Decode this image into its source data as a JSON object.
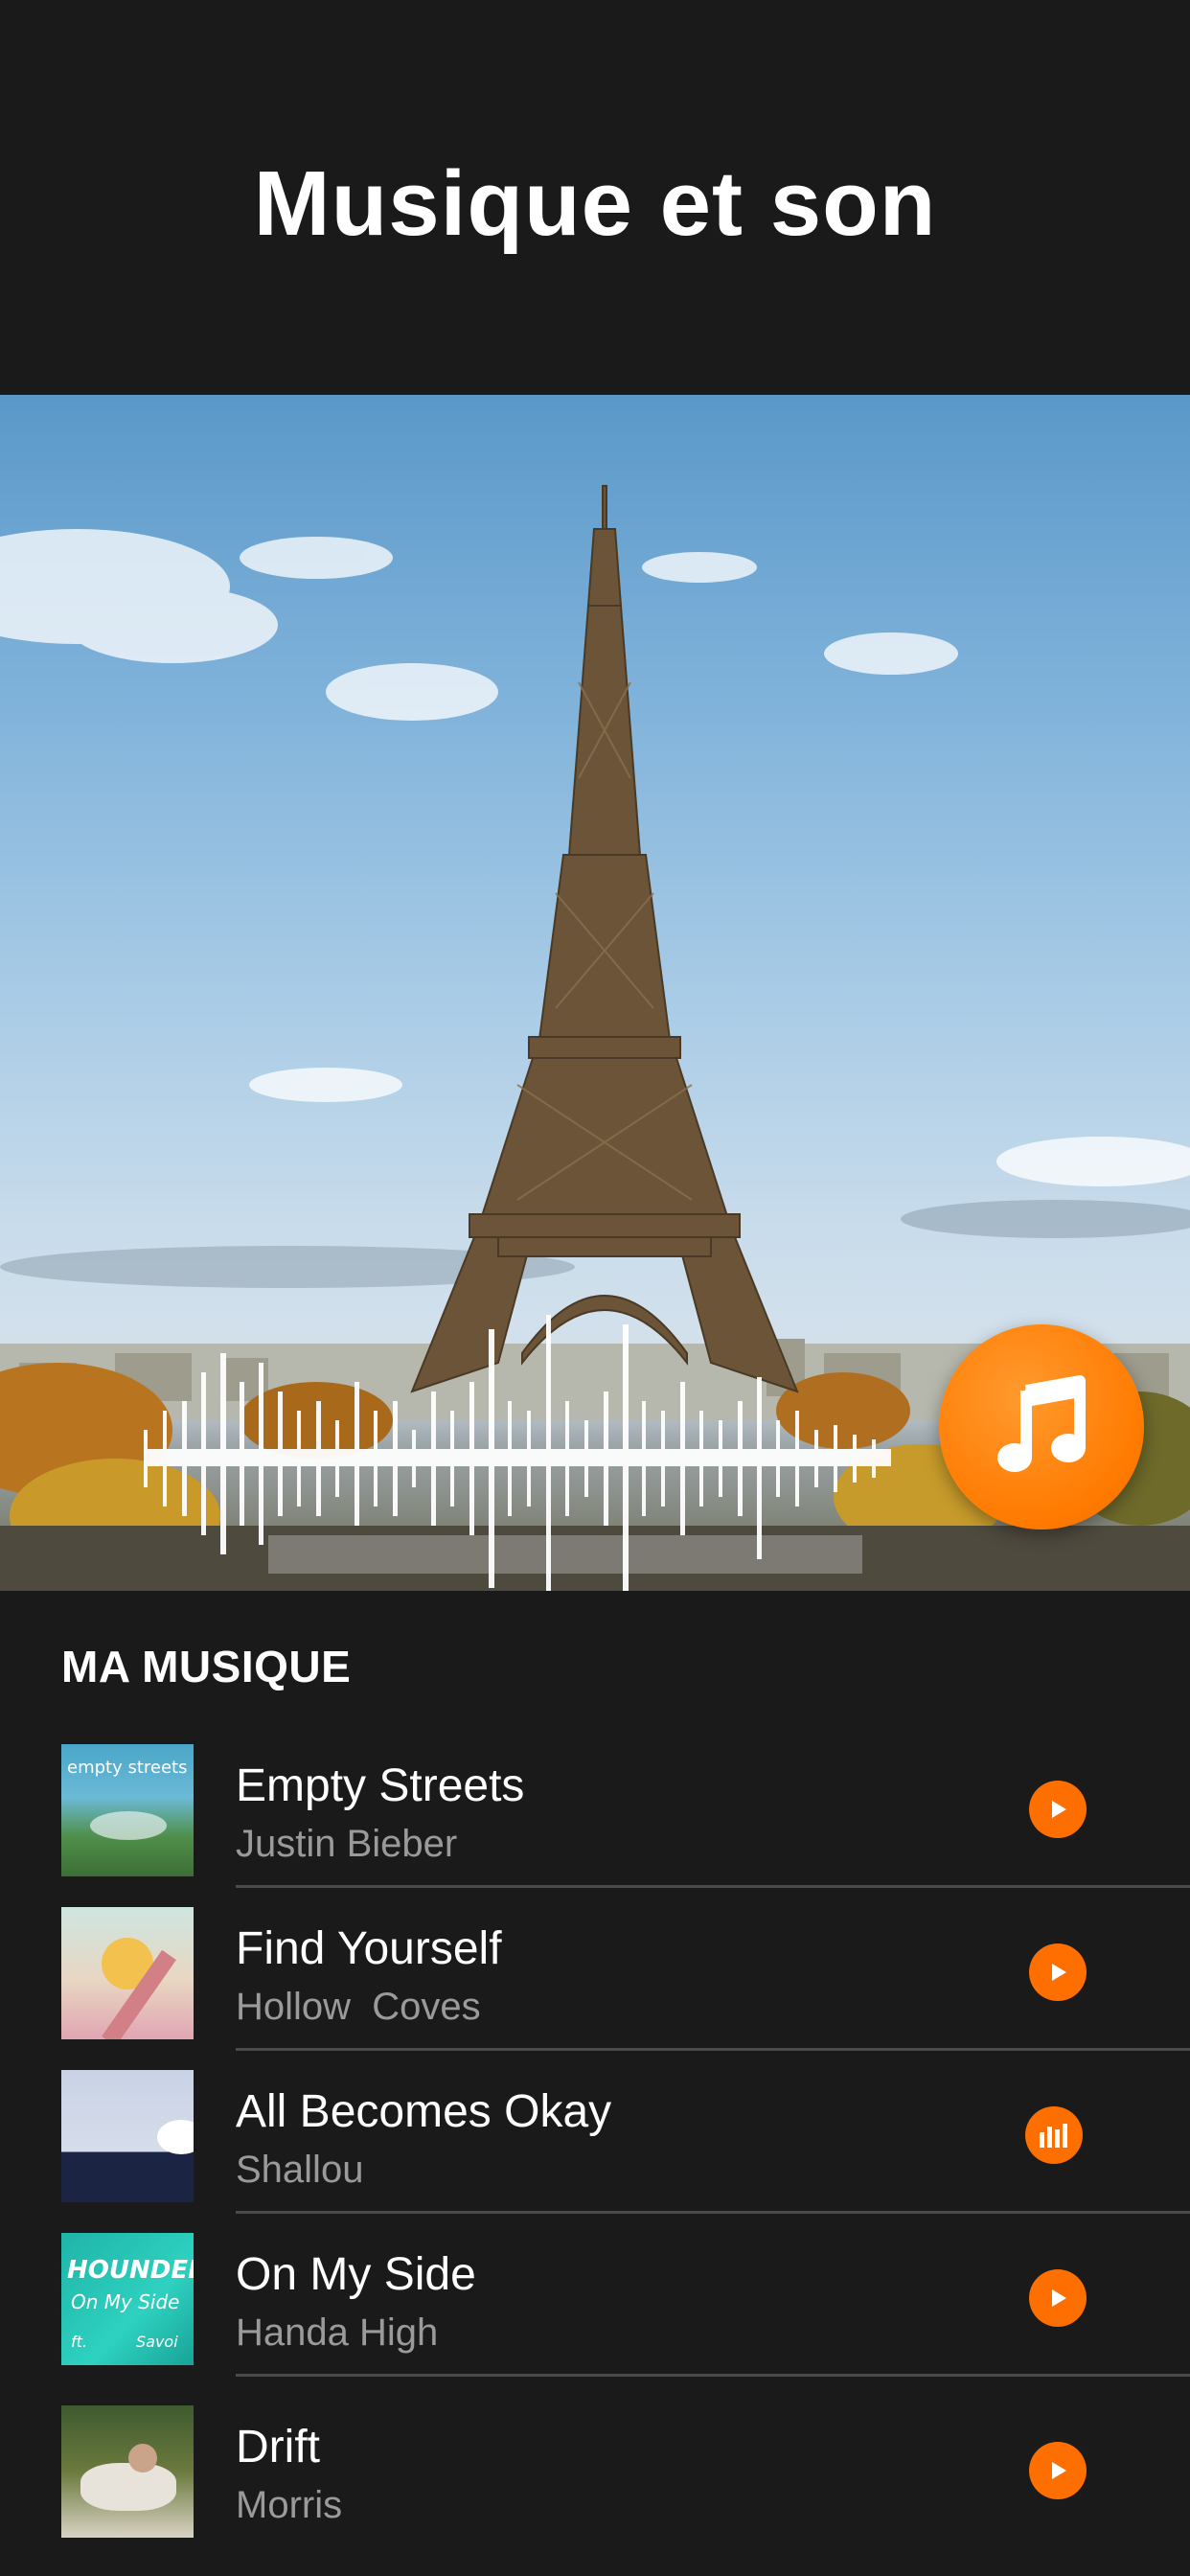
{
  "header": {
    "title": "Musique et son"
  },
  "section": {
    "title": "MA MUSIQUE"
  },
  "cover_texts": {
    "empty_streets": "empty streets",
    "hounded_line1": "HOUNDED",
    "hounded_line2": "On My Side",
    "hounded_ft": "ft.",
    "hounded_savoi": "Savoi"
  },
  "tracks": [
    {
      "title": "Empty Streets",
      "artist": "Justin Bieber",
      "state": "play"
    },
    {
      "title": "Find Yourself",
      "artist": "Hollow  Coves",
      "state": "play"
    },
    {
      "title": "All Becomes Okay",
      "artist": "Shallou",
      "state": "playing"
    },
    {
      "title": "On My Side",
      "artist": "Handa High",
      "state": "play"
    },
    {
      "title": "Drift",
      "artist": "Morris",
      "state": "play"
    }
  ],
  "colors": {
    "accent": "#ff6f00",
    "background": "#1a1a1a",
    "secondary_text": "#9a9a9a"
  },
  "icons": {
    "fab": "music-note-icon",
    "play": "play-icon",
    "playing": "equalizer-icon"
  }
}
